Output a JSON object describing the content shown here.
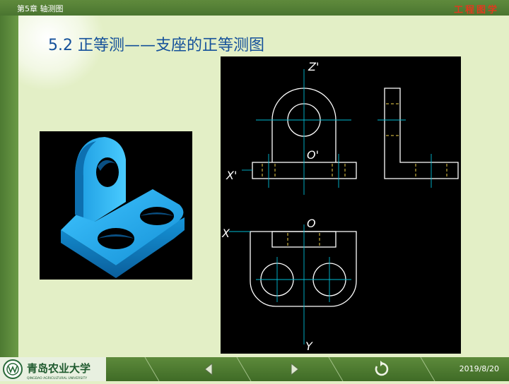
{
  "header": {
    "chapter": "第5章  轴测图",
    "brand": "工程图学"
  },
  "title": "5.2  正等测——支座的正等测图",
  "drawing": {
    "labels": {
      "z_axis": "Z'",
      "origin_front": "O'",
      "x_axis_front": "X'",
      "origin_top": "O",
      "x_axis_top": "X",
      "y_axis": "Y"
    }
  },
  "footer": {
    "university": "青岛农业大学",
    "university_en": "QINGDAO AGRICULTURAL UNIVERSITY",
    "date": "2019/8/20"
  },
  "colors": {
    "title": "#14509a",
    "brand": "#e03a1e",
    "model": "#1aa6e6",
    "center_lines": "#00bcd4",
    "hidden_lines": "#f0d24a"
  },
  "icons": [
    "university-logo-icon",
    "previous-slide-icon",
    "next-slide-icon",
    "return-icon"
  ]
}
